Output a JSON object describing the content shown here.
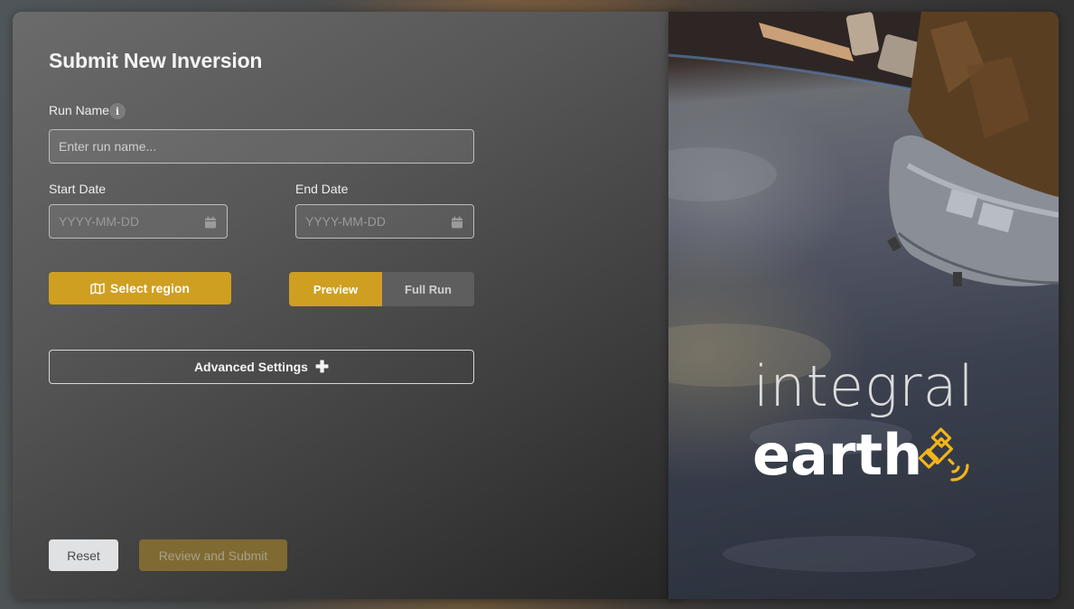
{
  "form": {
    "title": "Submit New Inversion",
    "run_name": {
      "label": "Run Name",
      "info_icon": "info-icon",
      "placeholder": "Enter run name...",
      "value": ""
    },
    "start_date": {
      "label": "Start Date",
      "placeholder": "YYYY-MM-DD",
      "icon": "calendar-icon"
    },
    "end_date": {
      "label": "End Date",
      "placeholder": "YYYY-MM-DD",
      "icon": "calendar-icon"
    },
    "select_region": {
      "label": "Select region",
      "icon": "map-icon"
    },
    "mode_toggle": {
      "options": [
        "Preview",
        "Full Run"
      ],
      "selected": "Preview"
    },
    "advanced_settings": {
      "label": "Advanced Settings",
      "icon": "plus-icon"
    },
    "reset_label": "Reset",
    "submit_label": "Review and Submit"
  },
  "brand": {
    "line1": "integral",
    "line2": "earth",
    "icon": "satellite-icon",
    "accent": "#F2B519"
  },
  "colors": {
    "accent": "#CF9F22",
    "submit_disabled": "#7F6A32",
    "reset_bg": "#E0E1E3"
  }
}
